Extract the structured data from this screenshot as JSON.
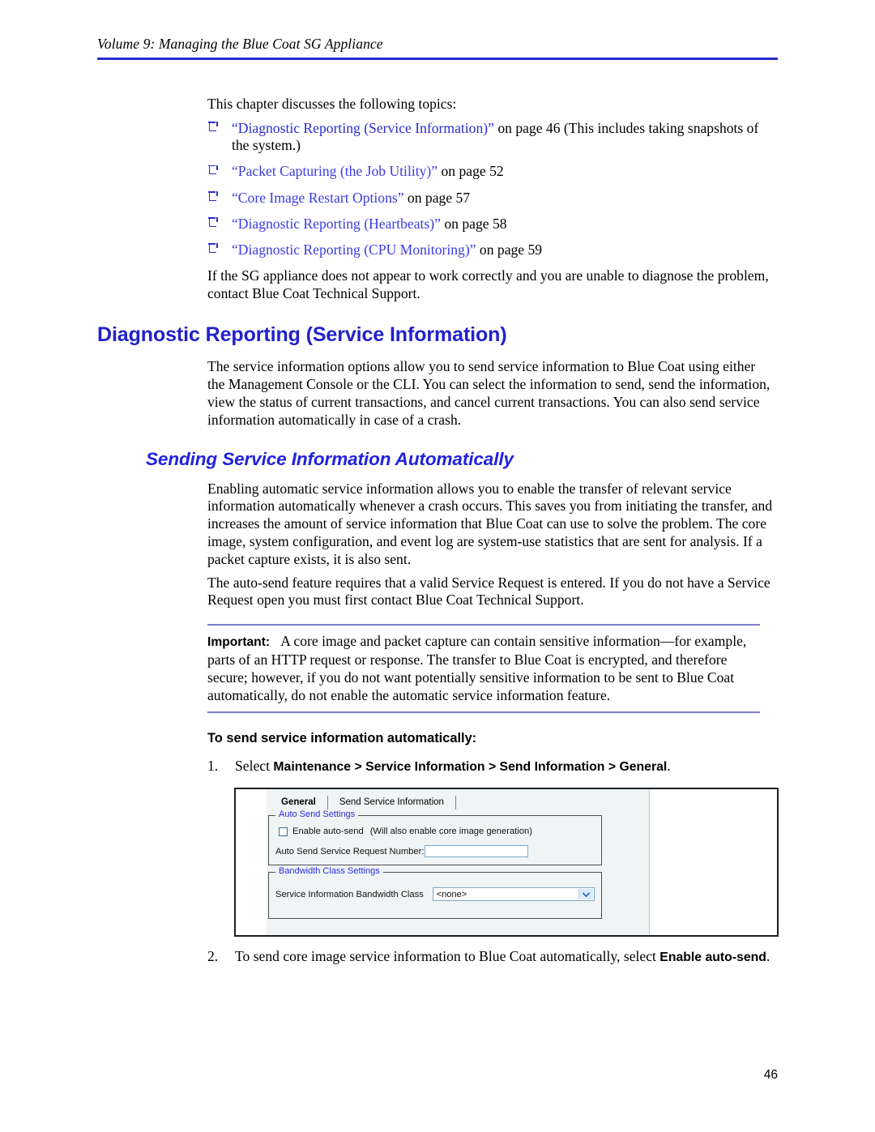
{
  "header": {
    "running_title": "Volume 9: Managing the Blue Coat SG Appliance",
    "rule_color": "#2A2AD0"
  },
  "intro": {
    "lead": "This chapter discusses the following topics:",
    "topics": [
      {
        "link": "“Diagnostic Reporting (Service Information)”",
        "tail": "  on page 46 (This includes taking snapshots of the system.)"
      },
      {
        "link": "“Packet Capturing (the Job Utility)”",
        "tail": "  on page 52"
      },
      {
        "link": "“Core Image Restart Options”",
        "tail": "  on page 57"
      },
      {
        "link": "“Diagnostic Reporting (Heartbeats)”",
        "tail": "  on page 58"
      },
      {
        "link": "“Diagnostic Reporting (CPU Monitoring)”",
        "tail": "  on page 59"
      }
    ],
    "closing": "If the SG appliance does not appear to work correctly and you are unable to diagnose the problem, contact Blue Coat Technical Support."
  },
  "section1": {
    "heading": "Diagnostic Reporting (Service Information)",
    "heading_color": "#2121CC",
    "paragraph": "The service information options allow you to send service information to Blue Coat using either the Management Console or the CLI. You can select the information to send, send the information, view the status of current transactions, and cancel current transactions. You can also send service information automatically in case of a crash."
  },
  "section2": {
    "heading": "Sending Service Information Automatically",
    "heading_color": "#2121E0",
    "paragraph1": "Enabling automatic service information allows you to enable the transfer of relevant service information automatically whenever a crash occurs. This saves you from initiating the transfer, and increases the amount of service information that Blue Coat can use to solve the problem. The core image, system configuration, and event log are system-use statistics that are sent for analysis. If a packet capture exists, it is also sent.",
    "paragraph2": "The auto-send feature requires that a valid Service Request is entered. If you do not have a Service Request open you must first contact Blue Coat Technical Support."
  },
  "callout": {
    "label": "Important:",
    "text": "A core image and packet capture can contain sensitive information—for example, parts of an HTTP request or response. The transfer to Blue Coat is encrypted, and therefore secure; however, if you do not want potentially sensitive information to be sent to Blue Coat automatically, do not enable the automatic service information feature.",
    "rule_color": "#7E7ECD"
  },
  "procedure": {
    "title": "To send service information automatically:",
    "steps": [
      {
        "num": "1.",
        "prefix": "Select ",
        "path": "Maintenance > Service Information > Send Information > General",
        "suffix": "."
      },
      {
        "num": "2.",
        "prefix": "To send core image service information to Blue Coat automatically, select ",
        "path": "Enable auto-send",
        "suffix": "."
      }
    ]
  },
  "screenshot": {
    "tabs": [
      {
        "label": "General",
        "active": true
      },
      {
        "label": "Send Service Information",
        "active": false
      }
    ],
    "groups": {
      "auto_send": {
        "legend": "Auto Send Settings",
        "checkbox_label": "Enable auto-send",
        "checkbox_checked": false,
        "checkbox_hint": "(Will also enable core image generation)",
        "field_label": "Auto Send Service Request Number:",
        "field_value": ""
      },
      "bandwidth": {
        "legend": "Bandwidth Class Settings",
        "field_label": "Service Information Bandwidth Class",
        "select_value": "<none>"
      }
    },
    "legend_color": "#2b2bdd"
  },
  "footer": {
    "page_number": "46"
  }
}
